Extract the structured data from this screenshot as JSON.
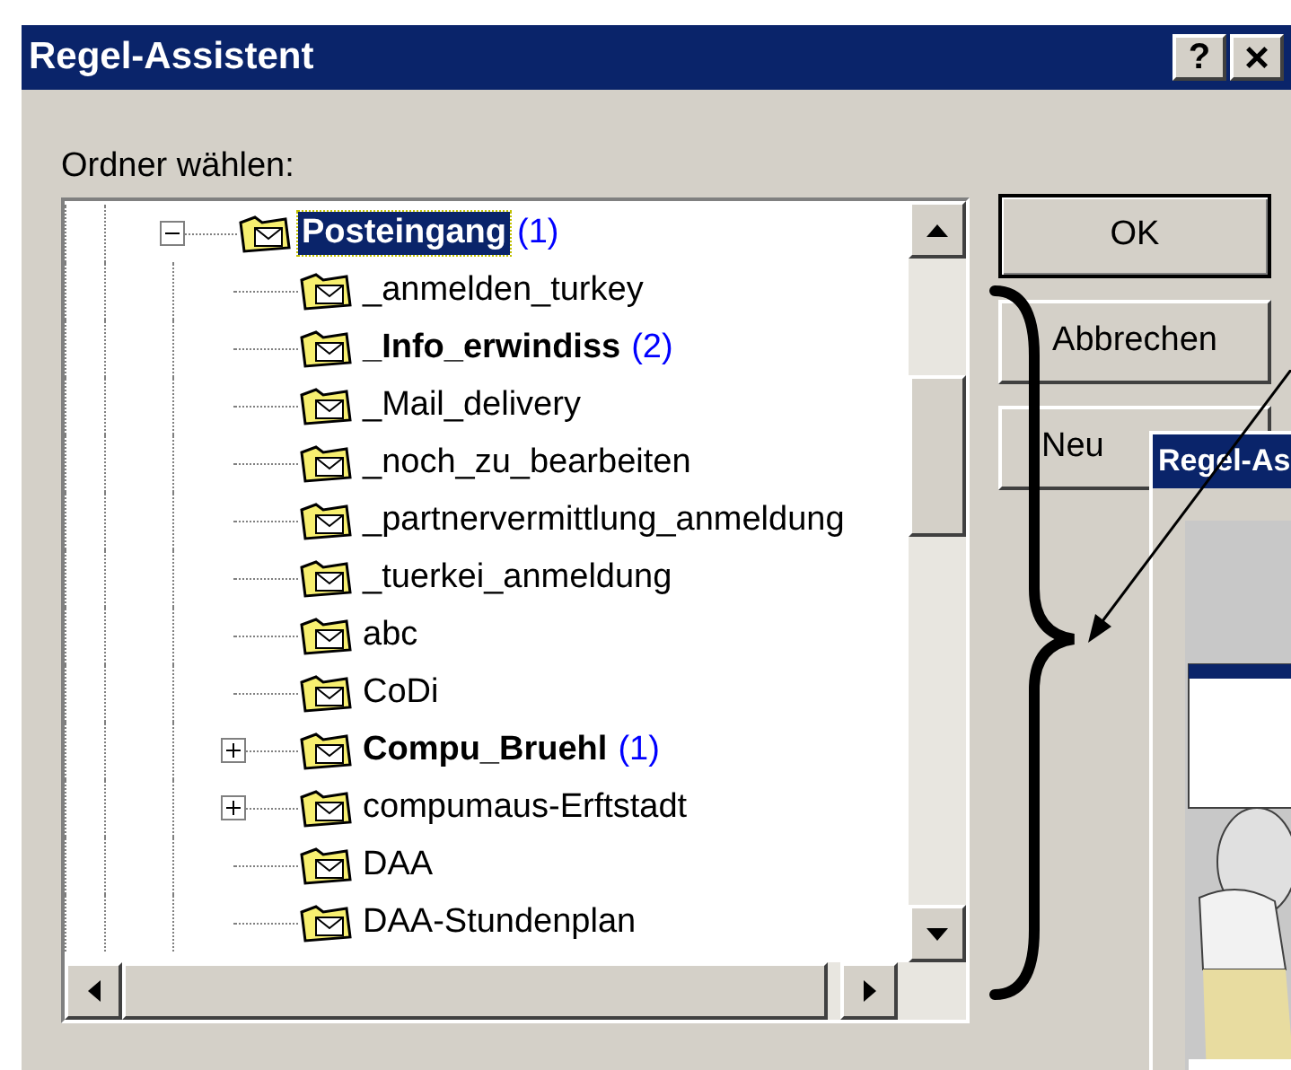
{
  "window": {
    "title": "Regel-Assistent",
    "help_button": "?",
    "close_button": "×"
  },
  "folder_label": "Ordner wählen:",
  "tree": [
    {
      "label": "Posteingang",
      "count": "(1)",
      "selected": true,
      "expanded": true,
      "children": [
        {
          "label": "_anmelden_turkey",
          "selected": false
        },
        {
          "label": "_Info_erwindiss",
          "count": "(2)",
          "selected": false
        },
        {
          "label": "_Mail_delivery",
          "selected": false
        },
        {
          "label": "_noch_zu_bearbeiten",
          "selected": false
        },
        {
          "label": "_partnervermittlung_anmeldung",
          "selected": false
        },
        {
          "label": "_tuerkei_anmeldung",
          "selected": false
        },
        {
          "label": "abc",
          "selected": false
        },
        {
          "label": "CoDi",
          "selected": false
        },
        {
          "label": "Compu_Bruehl",
          "count": "(1)",
          "selected": false,
          "expanded": false
        },
        {
          "label": "compumaus-Erftstadt",
          "selected": false,
          "expanded": false
        },
        {
          "label": "DAA",
          "selected": false
        },
        {
          "label": "DAA-Stundenplan",
          "selected": false
        }
      ]
    }
  ],
  "buttons": [
    "OK",
    "Abbrechen",
    "Neu"
  ],
  "inset_window": {
    "title": "Regel-As"
  }
}
